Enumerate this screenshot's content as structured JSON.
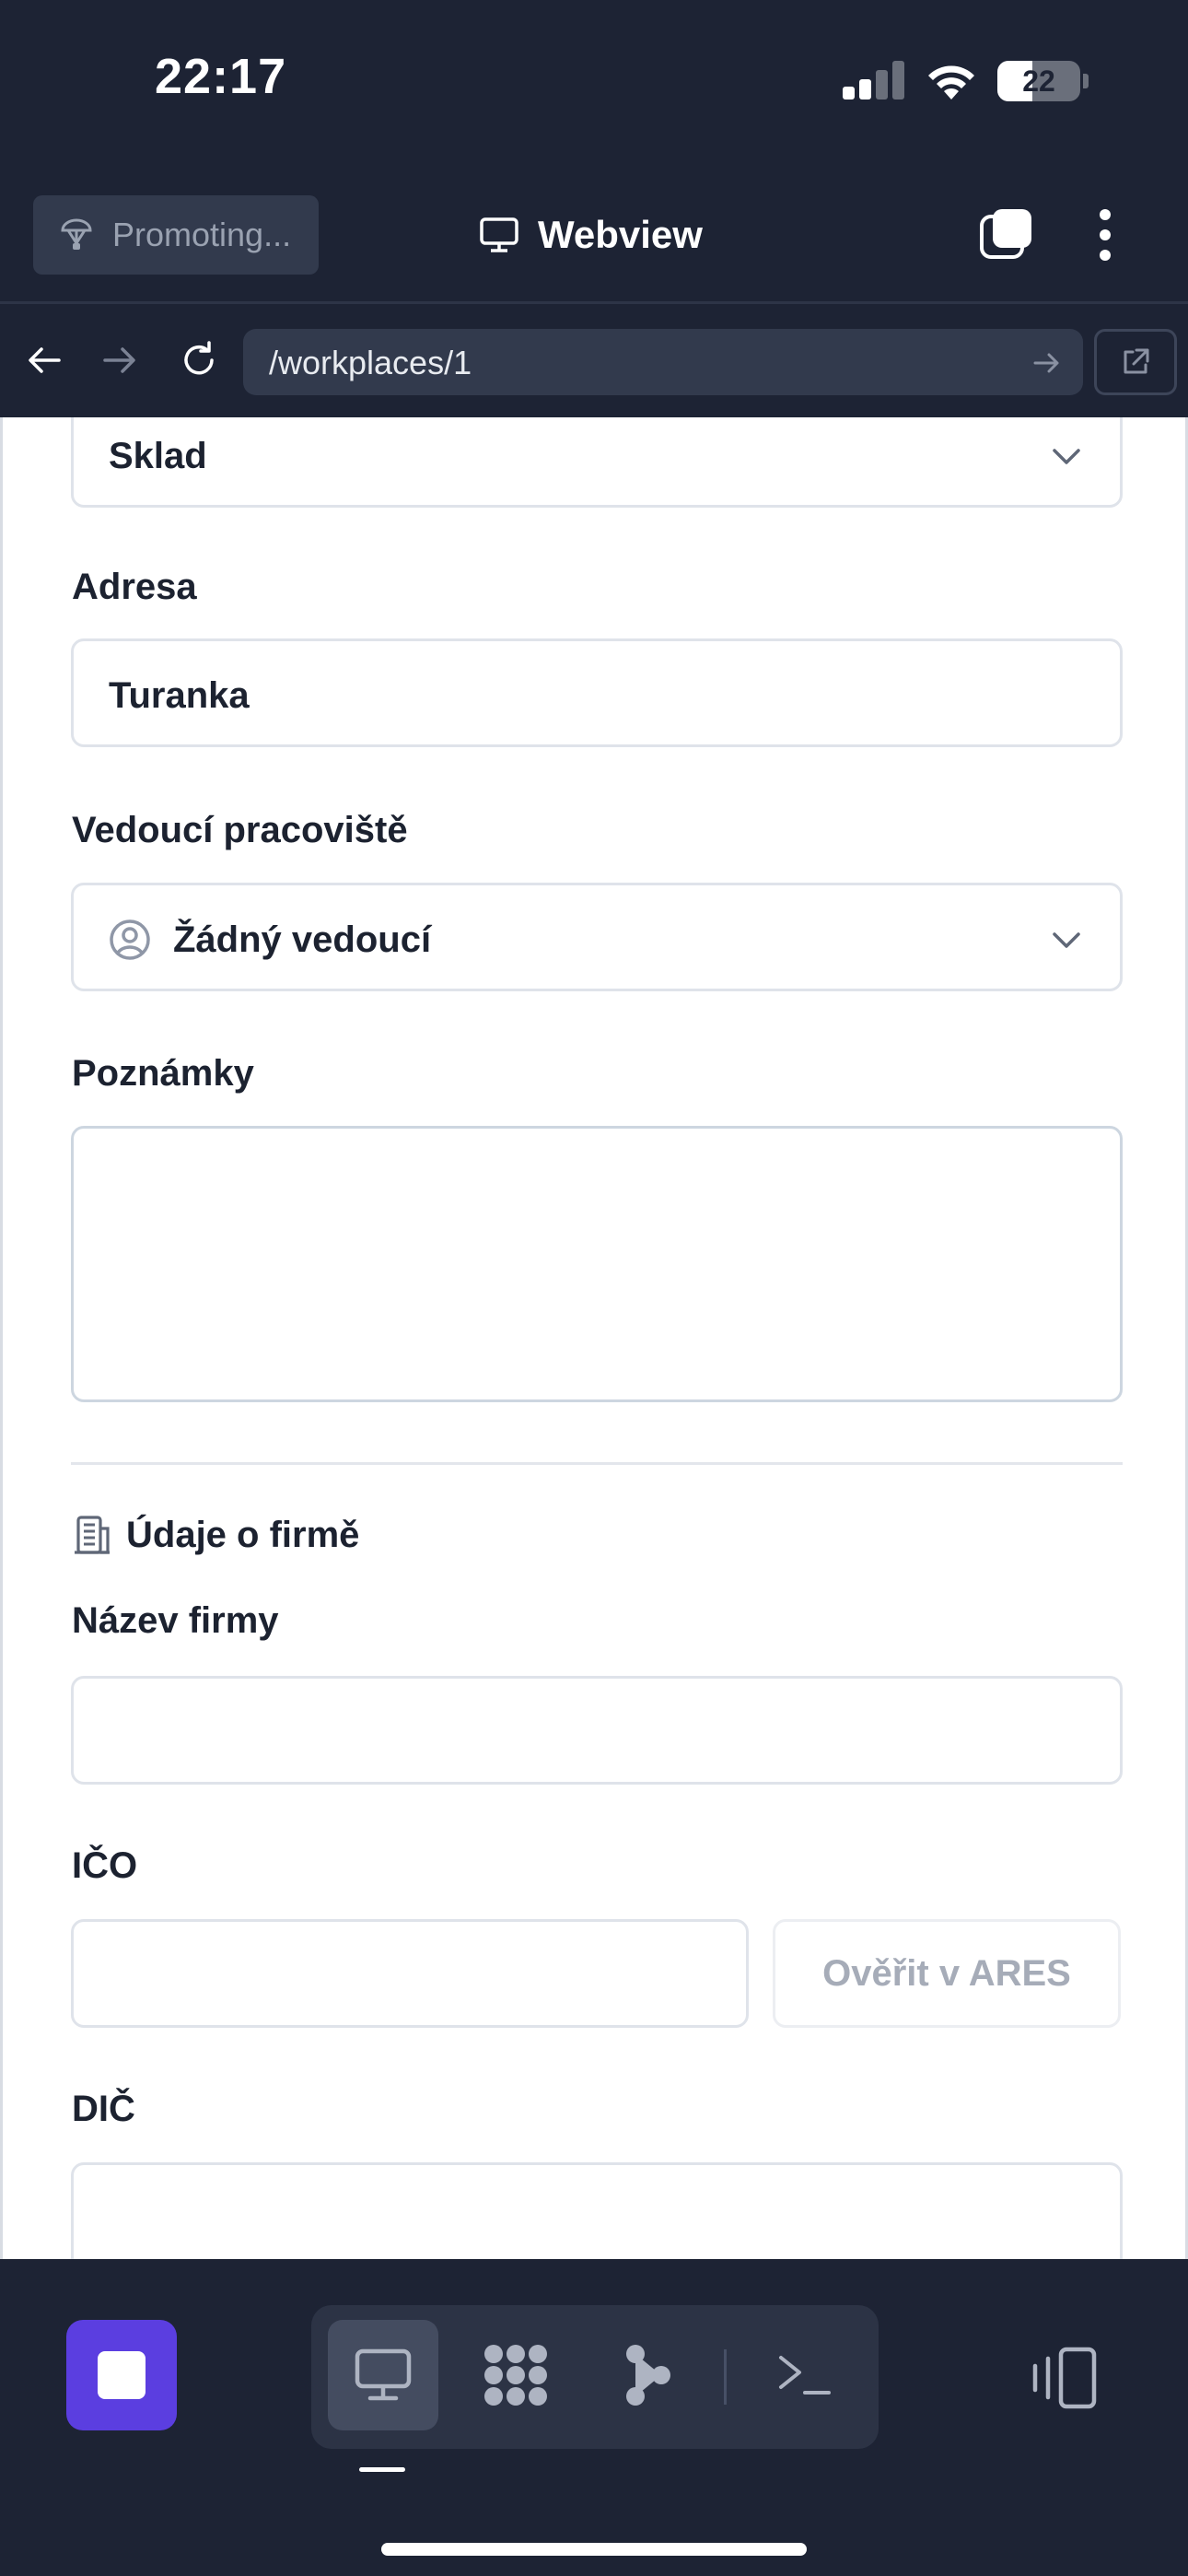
{
  "status_bar": {
    "time": "22:17",
    "battery": "22",
    "battery_level": 0.22
  },
  "header": {
    "promo_label": "Promoting...",
    "title": "Webview"
  },
  "browser": {
    "url": "/workplaces/1"
  },
  "form": {
    "type_value": "Sklad",
    "address": {
      "label": "Adresa",
      "value": "Turanka"
    },
    "manager": {
      "label": "Vedoucí pracoviště",
      "value": "Žádný vedoucí"
    },
    "notes": {
      "label": "Poznámky",
      "value": ""
    },
    "company_section": {
      "title": "Údaje o firmě",
      "company_name": {
        "label": "Název firmy",
        "value": ""
      },
      "ico": {
        "label": "IČO",
        "value": "",
        "verify_button": "Ověřit v ARES"
      },
      "dic": {
        "label": "DIČ",
        "value": ""
      }
    }
  },
  "colors": {
    "chrome_bg": "#1d2334",
    "accent": "#5b3ee0",
    "field_border": "#dfe3ea"
  },
  "icons": {
    "promo": "paragliding-icon",
    "webview": "monitor-icon",
    "tabs": "tabs-icon",
    "more": "more-vertical-icon",
    "back": "arrow-left-icon",
    "forward": "arrow-right-icon",
    "reload": "reload-icon",
    "go": "arrow-right-icon",
    "open_external": "external-link-icon",
    "manager": "user-circle-icon",
    "company": "building-icon",
    "stop": "stop-icon",
    "toolbar": [
      "monitor-icon",
      "grid-icon",
      "share-node-icon",
      "terminal-icon"
    ],
    "rotate": "rotate-device-icon"
  }
}
